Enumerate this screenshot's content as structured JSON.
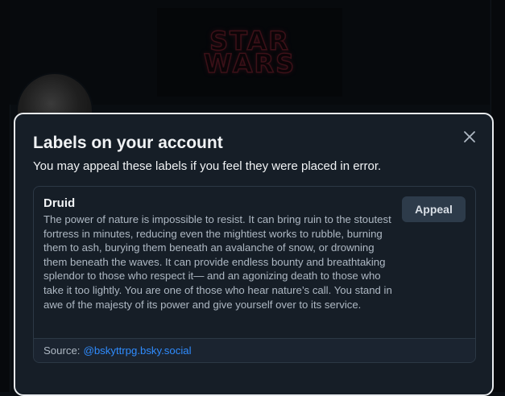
{
  "background": {
    "banner_logo_lines": [
      "STAR",
      "WARS"
    ]
  },
  "modal": {
    "title": "Labels on your account",
    "subtitle": "You may appeal these labels if you feel they were placed in error.",
    "close_icon": "close-icon",
    "labels": [
      {
        "name": "Druid",
        "description": "The power of nature is impossible to resist. It can bring ruin to the stoutest fortress in minutes, reducing even the mightiest works to rubble, burning them to ash, burying them beneath an avalanche of snow, or drowning them beneath the waves. It can provide endless bounty and breathtaking splendor to those who respect it— and an agonizing death to those who take it too lightly. You are one of those who hear nature’s call. You stand in awe of the majesty of its power and give yourself over to its service.",
        "appeal_label": "Appeal",
        "source_prefix": "Source:",
        "source_handle": "@bskyttrpg.bsky.social"
      }
    ]
  },
  "colors": {
    "modal_bg": "#161e27",
    "modal_border": "#e8ebee",
    "link": "#2f8cff",
    "appeal_bg": "#2d3b4a"
  }
}
